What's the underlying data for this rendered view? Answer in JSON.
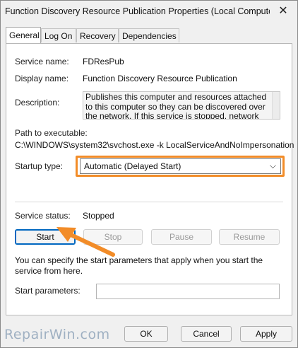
{
  "window": {
    "title": "Function Discovery Resource Publication Properties (Local Computer)",
    "close_glyph": "✕"
  },
  "tabs": [
    {
      "label": "General",
      "active": true
    },
    {
      "label": "Log On",
      "active": false
    },
    {
      "label": "Recovery",
      "active": false
    },
    {
      "label": "Dependencies",
      "active": false
    }
  ],
  "general": {
    "service_name_label": "Service name:",
    "service_name_value": "FDResPub",
    "display_name_label": "Display name:",
    "display_name_value": "Function Discovery Resource Publication",
    "description_label": "Description:",
    "description_value": "Publishes this computer and resources attached to this computer so they can be discovered over the network.  If this service is stopped, network",
    "path_label": "Path to executable:",
    "path_value": "C:\\WINDOWS\\system32\\svchost.exe -k LocalServiceAndNoImpersonation",
    "startup_type_label": "Startup type:",
    "startup_type_value": "Automatic (Delayed Start)",
    "service_status_label": "Service status:",
    "service_status_value": "Stopped",
    "buttons": {
      "start": "Start",
      "stop": "Stop",
      "pause": "Pause",
      "resume": "Resume"
    },
    "info_text": "You can specify the start parameters that apply when you start the service from here.",
    "start_params_label": "Start parameters:",
    "start_params_value": ""
  },
  "footer": {
    "ok": "OK",
    "cancel": "Cancel",
    "apply": "Apply"
  },
  "watermark": "RepairWin.com",
  "colors": {
    "highlight": "#f28c28",
    "primary_border": "#0067c0"
  }
}
